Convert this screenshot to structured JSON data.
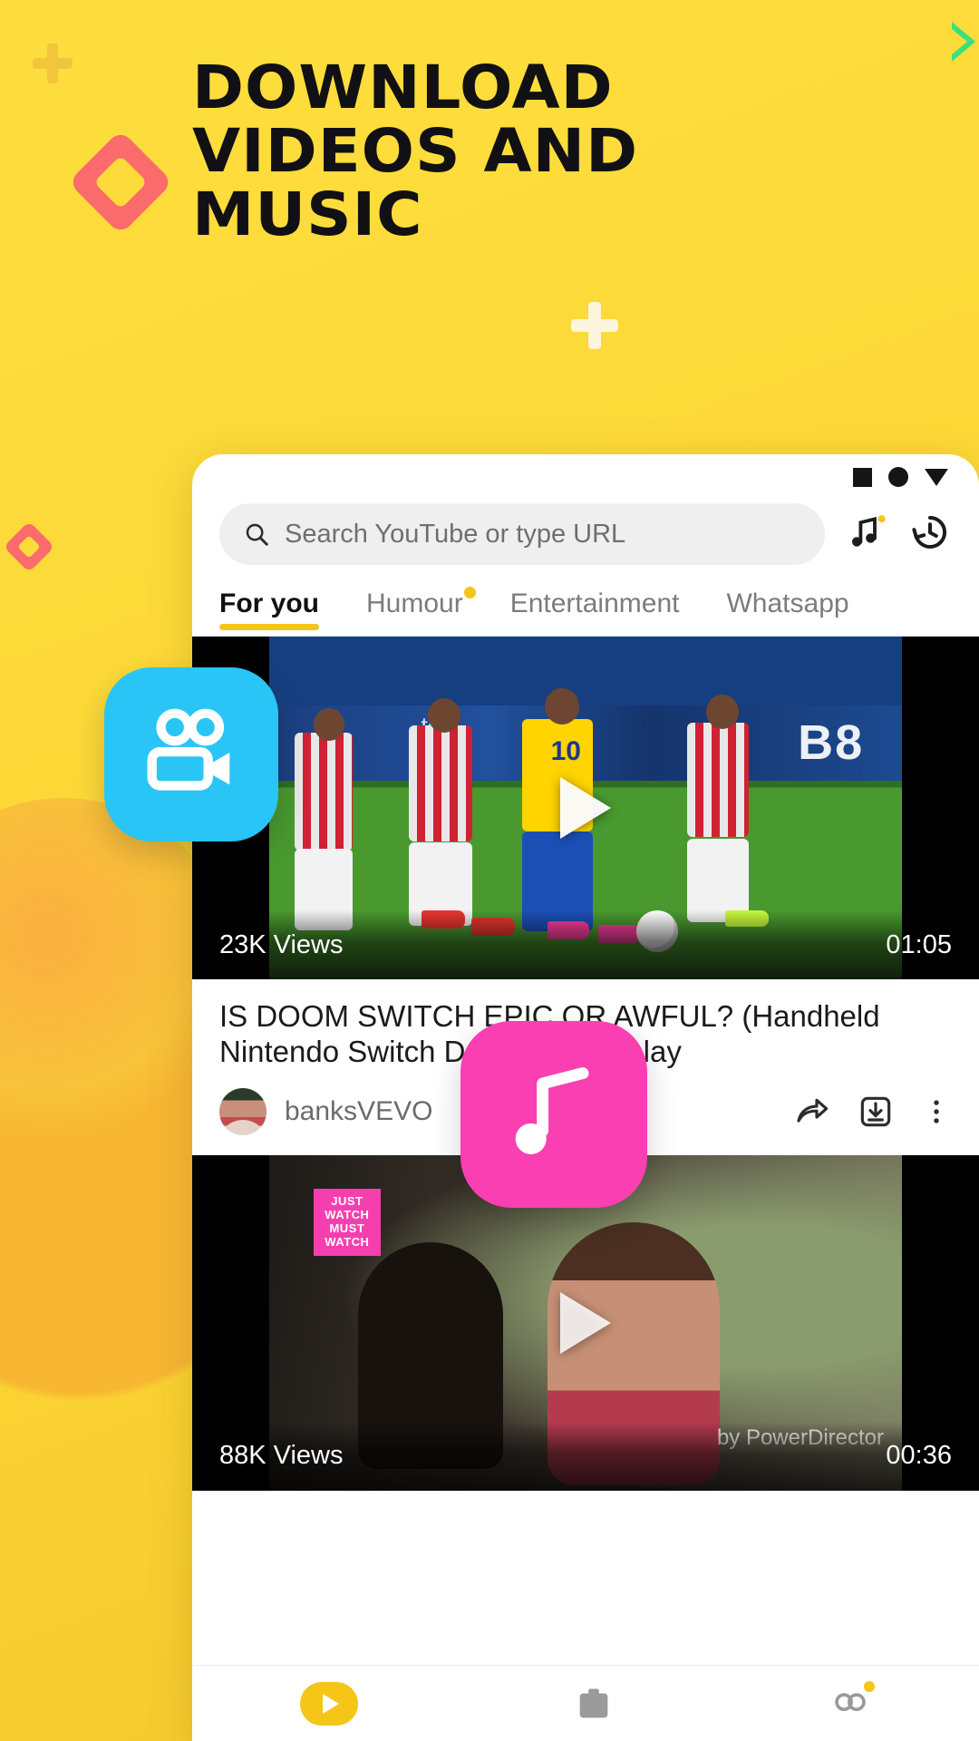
{
  "promo": {
    "headline_lines": [
      "Download",
      "Videos and",
      "Music"
    ],
    "background_color": "#FCDB3A",
    "accent_red": "#FB6B6B",
    "accent_green": "#3BE07E"
  },
  "floating_icons": [
    {
      "name": "video-camera-icon",
      "color": "#29C5F6"
    },
    {
      "name": "music-note-icon",
      "color": "#F93FB1"
    }
  ],
  "app": {
    "statusbar": {
      "icons": [
        "square-icon",
        "circle-icon",
        "triangle-down-icon"
      ]
    },
    "search": {
      "placeholder": "Search YouTube or type URL",
      "icon": "search-icon",
      "actions": [
        {
          "name": "music-library-icon",
          "badge": true
        },
        {
          "name": "history-icon",
          "badge": false
        }
      ]
    },
    "tabs": [
      {
        "label": "For you",
        "active": true,
        "badge": false
      },
      {
        "label": "Humour",
        "active": false,
        "badge": true
      },
      {
        "label": "Entertainment",
        "active": false,
        "badge": false
      },
      {
        "label": "Whatsapp",
        "active": false,
        "badge": false
      }
    ],
    "feed": [
      {
        "views": "23K Views",
        "duration": "01:05",
        "title": "IS DOOM SWITCH EPIC OR AWFUL? (Handheld Nintendo Switch DOOM Gameplay",
        "channel": "banksVEVO",
        "actions": [
          "share-icon",
          "download-icon",
          "more-vertical-icon"
        ],
        "play_icon": "play-icon",
        "scoreboard_text": "B8",
        "jersey_number": "10"
      },
      {
        "views": "88K Views",
        "duration": "00:36",
        "watermark": "by PowerDirector",
        "sticker_text": "JUST WATCH MUST WATCH",
        "play_icon": "play-icon"
      }
    ],
    "bottom_nav": [
      {
        "name": "nav-play",
        "badge": false
      },
      {
        "name": "nav-downloads",
        "badge": false
      },
      {
        "name": "nav-profile",
        "badge": true
      }
    ]
  }
}
